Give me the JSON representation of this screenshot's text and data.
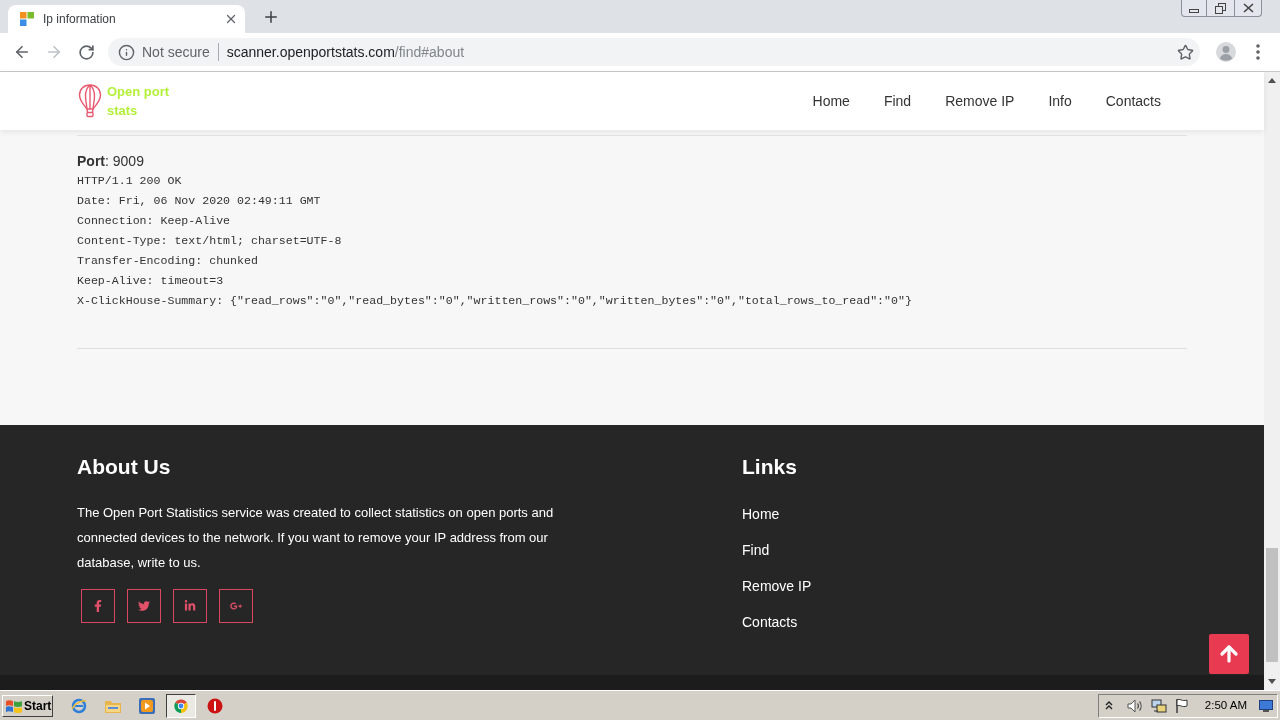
{
  "browser": {
    "tab": {
      "title": "Ip information"
    },
    "address": {
      "security": "Not secure",
      "host": "scanner.openportstats.com",
      "path": "/find#about"
    }
  },
  "header": {
    "logo": "Open port stats",
    "nav": [
      {
        "label": "Home"
      },
      {
        "label": "Find"
      },
      {
        "label": "Remove IP"
      },
      {
        "label": "Info"
      },
      {
        "label": "Contacts"
      }
    ]
  },
  "result": {
    "port": "**Port**: 9009",
    "lines": [
      "HTTP/1.1 200 OK",
      "Date: Fri, 06 Nov 2020 02:49:11 GMT",
      "Connection: Keep-Alive",
      "Content-Type: text/html; charset=UTF-8",
      "Transfer-Encoding: chunked",
      "Keep-Alive: timeout=3",
      "X-ClickHouse-Summary: {\"read_rows\":\"0\",\"read_bytes\":\"0\",\"written_rows\":\"0\",\"written_bytes\":\"0\",\"total_rows_to_read\":\"0\"}"
    ]
  },
  "footer": {
    "about": {
      "title": "About Us",
      "text": "The Open Port Statistics service was created to collect statistics on open ports and connected devices to the network. If you want to remove your IP address from our database, write to us."
    },
    "social": [
      {
        "kind": "facebook"
      },
      {
        "kind": "twitter"
      },
      {
        "kind": "linkedin"
      },
      {
        "kind": "googleplus"
      }
    ],
    "links": {
      "title": "Links",
      "items": [
        "Home",
        "Find",
        "Remove IP",
        "Contacts"
      ]
    }
  },
  "taskbar": {
    "start": "Start",
    "apps": [
      {
        "kind": "globe",
        "selected": false
      },
      {
        "kind": "folder",
        "selected": false
      },
      {
        "kind": "player",
        "selected": false
      },
      {
        "kind": "browser",
        "selected": true
      },
      {
        "kind": "stop",
        "selected": false
      }
    ],
    "clock": "2:50 AM"
  }
}
